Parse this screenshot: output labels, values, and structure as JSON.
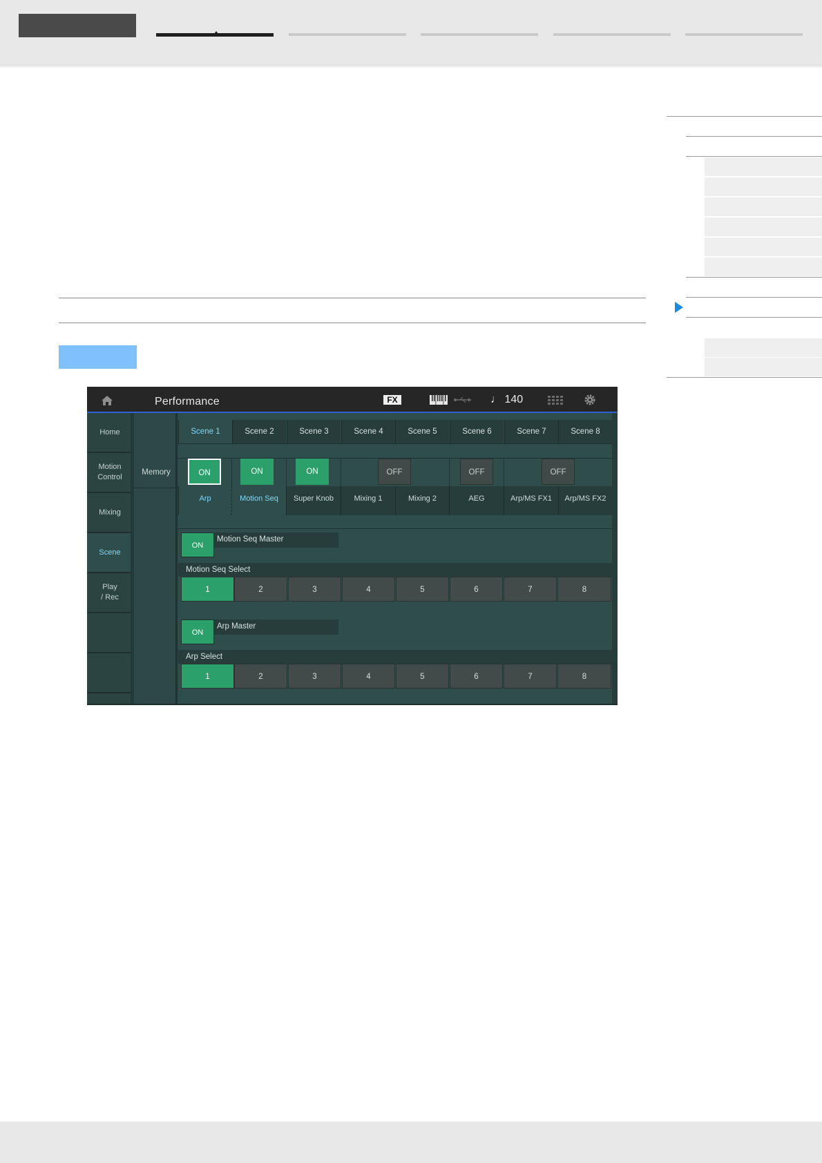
{
  "screen": {
    "title": "Performance",
    "fx_badge": "FX",
    "tempo": "♩ 140",
    "icons": [
      "home-icon",
      "fx-icon",
      "keyboard-icon",
      "usb-icon",
      "grid-icon",
      "gear-icon"
    ],
    "sidebar": [
      {
        "label": "Home"
      },
      {
        "label": "Motion\nControl"
      },
      {
        "label": "Mixing"
      },
      {
        "label": "Scene",
        "active": true
      },
      {
        "label": "Play\n/ Rec"
      },
      {
        "label": ""
      },
      {
        "label": ""
      }
    ],
    "memory_label": "Memory",
    "scenes": [
      "Scene 1",
      "Scene 2",
      "Scene 3",
      "Scene 4",
      "Scene 5",
      "Scene 6",
      "Scene 7",
      "Scene 8"
    ],
    "active_scene": 1,
    "memory_switches": [
      {
        "state": "ON",
        "label": "Arp"
      },
      {
        "state": "ON",
        "label": "Motion Seq"
      },
      {
        "state": "ON",
        "label": "Super Knob"
      },
      {
        "state": "OFF",
        "label": "Mixing 1"
      },
      {
        "state": "",
        "label": "Mixing 2"
      },
      {
        "state": "OFF",
        "label": "AEG"
      },
      {
        "state": "OFF",
        "label": "Arp/MS FX1"
      },
      {
        "state": "",
        "label": "Arp/MS FX2"
      }
    ],
    "motion_seq": {
      "master_state": "ON",
      "master_label": "Motion Seq Master",
      "select_label": "Motion Seq Select",
      "options": [
        "1",
        "2",
        "3",
        "4",
        "5",
        "6",
        "7",
        "8"
      ],
      "selected": "1"
    },
    "arp": {
      "master_state": "ON",
      "master_label": "Arp Master",
      "select_label": "Arp Select",
      "options": [
        "1",
        "2",
        "3",
        "4",
        "5",
        "6",
        "7",
        "8"
      ],
      "selected": "1"
    },
    "colors": {
      "accent_blue": "#7ed9ff",
      "on_green": "#2ca06b",
      "header_line": "#2e63d6",
      "page_highlight": "#80c1fb",
      "index_marker": "#1b8ae0"
    }
  }
}
